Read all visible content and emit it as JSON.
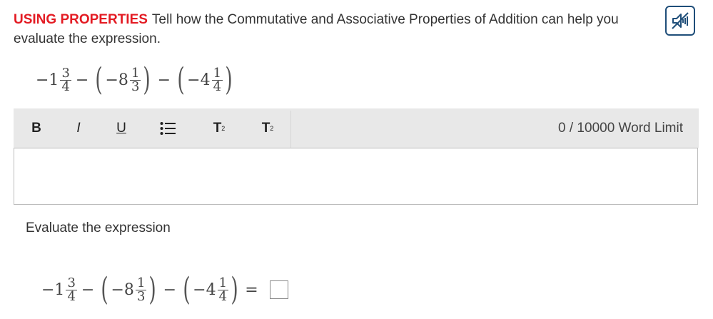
{
  "prompt": {
    "heading": "USING PROPERTIES",
    "text": "Tell how the Commutative and Associative Properties of Addition can help you evaluate the expression."
  },
  "expression": {
    "term1": {
      "whole": "−1",
      "num": "3",
      "den": "4"
    },
    "op1": "−",
    "term2": {
      "whole": "−8",
      "num": "1",
      "den": "3"
    },
    "op2": "−",
    "term3": {
      "whole": "−4",
      "num": "1",
      "den": "4"
    },
    "equals": "="
  },
  "toolbar": {
    "bold": "B",
    "italic": "I",
    "underline": "U",
    "superscript": "T",
    "superscript_mark": "2",
    "subscript": "T",
    "subscript_mark": "2",
    "word_limit": "0 / 10000 Word Limit"
  },
  "evaluate_label": "Evaluate the expression",
  "colors": {
    "heading": "#e31b23",
    "toolbar_bg": "#e8e8e8",
    "audio_border": "#1f4e79"
  },
  "icons": [
    "audio-off-icon",
    "list-icon"
  ]
}
